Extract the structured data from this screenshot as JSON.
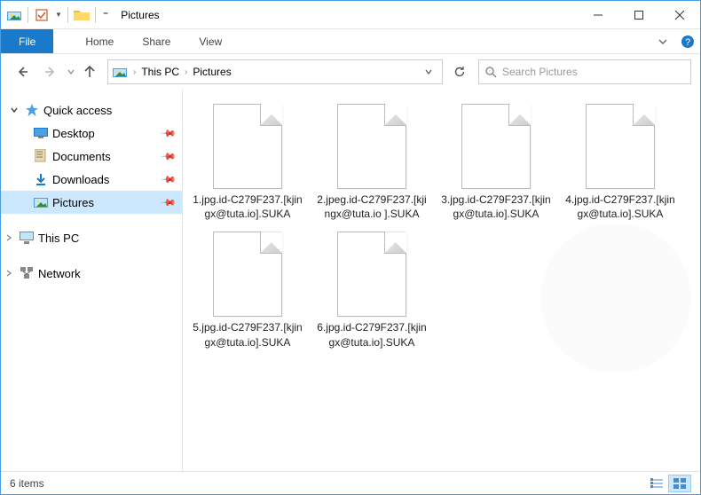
{
  "window": {
    "title": "Pictures"
  },
  "ribbon": {
    "file": "File",
    "tabs": [
      "Home",
      "Share",
      "View"
    ]
  },
  "breadcrumb": {
    "parts": [
      "This PC",
      "Pictures"
    ]
  },
  "search": {
    "placeholder": "Search Pictures"
  },
  "sidebar": {
    "quick_access": "Quick access",
    "items": [
      {
        "label": "Desktop",
        "icon": "desktop"
      },
      {
        "label": "Documents",
        "icon": "documents"
      },
      {
        "label": "Downloads",
        "icon": "downloads"
      },
      {
        "label": "Pictures",
        "icon": "pictures",
        "selected": true
      }
    ],
    "this_pc": "This PC",
    "network": "Network"
  },
  "files": [
    "1.jpg.id-C279F237.[kjingx@tuta.io].SUKA",
    "2.jpeg.id-C279F237.[kjingx@tuta.io ].SUKA",
    "3.jpg.id-C279F237.[kjingx@tuta.io].SUKA",
    "4.jpg.id-C279F237.[kjingx@tuta.io].SUKA",
    "5.jpg.id-C279F237.[kjingx@tuta.io].SUKA",
    "6.jpg.id-C279F237.[kjingx@tuta.io].SUKA"
  ],
  "status": {
    "text": "6 items"
  }
}
